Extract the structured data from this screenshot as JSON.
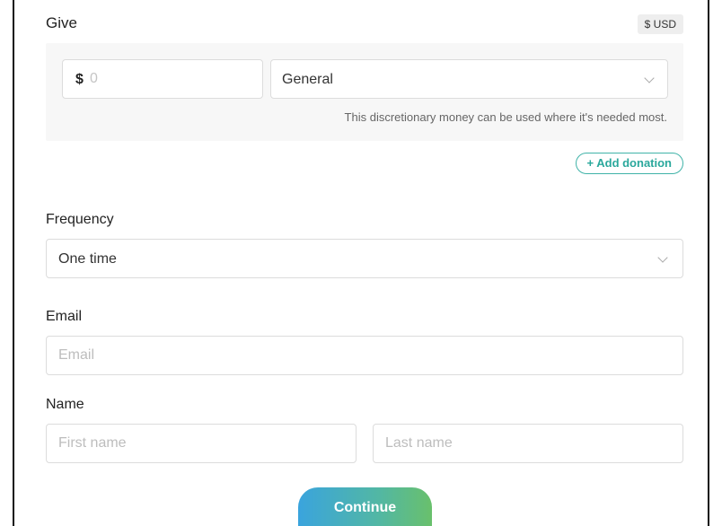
{
  "give": {
    "title": "Give",
    "currency_badge": "$ USD",
    "amount": {
      "symbol": "$",
      "placeholder": "0",
      "value": ""
    },
    "fund": {
      "selected": "General",
      "description": "This discretionary money can be used where it's needed most."
    },
    "add_donation_label": "+ Add donation"
  },
  "frequency": {
    "label": "Frequency",
    "selected": "One time"
  },
  "email": {
    "label": "Email",
    "placeholder": "Email"
  },
  "name": {
    "label": "Name",
    "first_placeholder": "First name",
    "last_placeholder": "Last name"
  },
  "continue_label": "Continue",
  "colors": {
    "accent_teal": "#2aa89c",
    "button_gradient_start": "#3aa4dd",
    "button_gradient_end": "#69c06c"
  },
  "icons": {
    "dropdown": "chevron-down-icon"
  }
}
